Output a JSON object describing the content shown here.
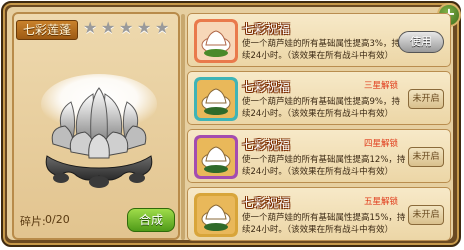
{
  "item": {
    "name": "七彩莲蓬",
    "star_count": 5,
    "star_icon": "star-icon",
    "shard_label": "碎片:",
    "shard_value": "0/20",
    "craft_label": "合成"
  },
  "top_right": {
    "icon": "plus-icon"
  },
  "cards": [
    {
      "title": "七彩祝福",
      "desc_line1": "使一个葫芦娃的所有基础属性提高3%，持",
      "desc_line2": "续24小时。（该效果在所有战斗中有效）",
      "unlock": "",
      "action": "使用",
      "icon_tint": "#e97a4c"
    },
    {
      "title": "七彩祝福",
      "desc_line1": "使一个葫芦娃的所有基础属性提高9%，持",
      "desc_line2": "续24小时。（该效果在所有战斗中有效）",
      "unlock": "三星解锁",
      "action": "未开启",
      "icon_tint": "#3fb4b6"
    },
    {
      "title": "七彩祝福",
      "desc_line1": "使一个葫芦娃的所有基础属性提高12%，持",
      "desc_line2": "续24小时。（该效果在所有战斗中有效）",
      "unlock": "四星解锁",
      "action": "未开启",
      "icon_tint": "#a44cb0"
    },
    {
      "title": "七彩祝福",
      "desc_line1": "使一个葫芦娃的所有基础属性提高15%，持",
      "desc_line2": "续24小时。（该效果在所有战斗中有效）",
      "unlock": "五星解锁",
      "action": "未开启",
      "icon_tint": "#d8a53a"
    }
  ]
}
